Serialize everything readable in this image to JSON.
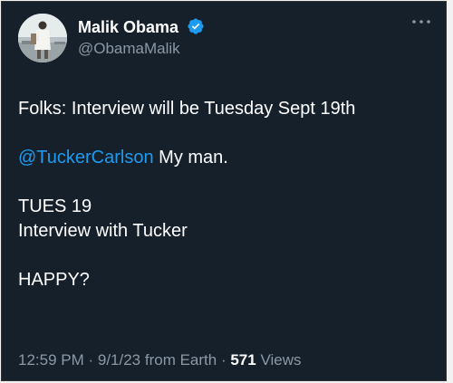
{
  "author": {
    "display_name": "Malik Obama",
    "handle": "@ObamaMalik",
    "verified": true,
    "avatar_icon": "profile-photo"
  },
  "tweet": {
    "line1": "Folks: Interview will be Tuesday Sept 19th",
    "mention": "@TuckerCarlson",
    "line2_rest": " My man.",
    "line3": "TUES 19",
    "line4": "Interview with Tucker",
    "line5": "HAPPY?"
  },
  "meta": {
    "time": "12:59 PM",
    "sep1": " · ",
    "date": "9/1/23",
    "source": " from Earth",
    "sep2": " · ",
    "views_count": "571",
    "views_label": " Views"
  },
  "colors": {
    "background": "#15202b",
    "accent": "#1d9bf0",
    "secondary_text": "#8b98a5"
  },
  "icons": {
    "verified": "verified-badge-icon",
    "more": "more-options-icon"
  }
}
